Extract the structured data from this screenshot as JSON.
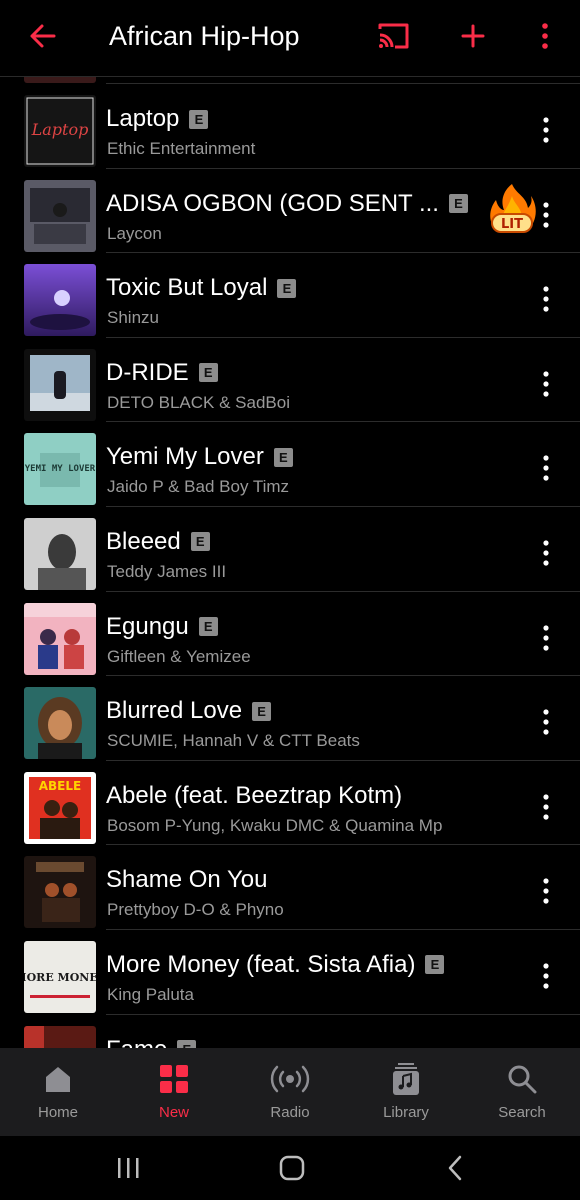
{
  "header": {
    "title": "African Hip-Hop"
  },
  "accent": "#fa2d48",
  "songs": [
    {
      "title": "Laptop",
      "artist": "Ethic Entertainment",
      "explicit": "E"
    },
    {
      "title": "ADISA OGBON (GOD SENT ...",
      "artist": "Laycon",
      "explicit": "E",
      "sticker": "LIT"
    },
    {
      "title": "Toxic But Loyal",
      "artist": "Shinzu",
      "explicit": "E"
    },
    {
      "title": "D-RIDE",
      "artist": "DETO BLACK & SadBoi",
      "explicit": "E"
    },
    {
      "title": "Yemi My Lover",
      "artist": "Jaido P & Bad Boy Timz",
      "explicit": "E"
    },
    {
      "title": "Bleeed",
      "artist": "Teddy James III",
      "explicit": "E"
    },
    {
      "title": "Egungu",
      "artist": "Giftleen & Yemizee",
      "explicit": "E"
    },
    {
      "title": "Blurred Love",
      "artist": "SCUMIE, Hannah V & CTT Beats",
      "explicit": "E"
    },
    {
      "title": "Abele (feat. Beeztrap Kotm)",
      "artist": "Bosom P-Yung, Kwaku DMC & Quamina Mp",
      "explicit": ""
    },
    {
      "title": "Shame On You",
      "artist": "Prettyboy D-O & Phyno",
      "explicit": ""
    },
    {
      "title": "More Money (feat. Sista Afia)",
      "artist": "King Paluta",
      "explicit": "E"
    },
    {
      "title": "Fame",
      "artist": "",
      "explicit": "E"
    }
  ],
  "artwork_text": {
    "laptop": "Laptop",
    "yemi": "YEMI MY LOVER",
    "abele": "ABELE",
    "more_money": "MORE MONEY"
  },
  "tabs": [
    {
      "label": "Home",
      "icon": "home-icon"
    },
    {
      "label": "New",
      "icon": "new-grid-icon",
      "active": true
    },
    {
      "label": "Radio",
      "icon": "radio-icon"
    },
    {
      "label": "Library",
      "icon": "library-icon"
    },
    {
      "label": "Search",
      "icon": "search-icon"
    }
  ]
}
